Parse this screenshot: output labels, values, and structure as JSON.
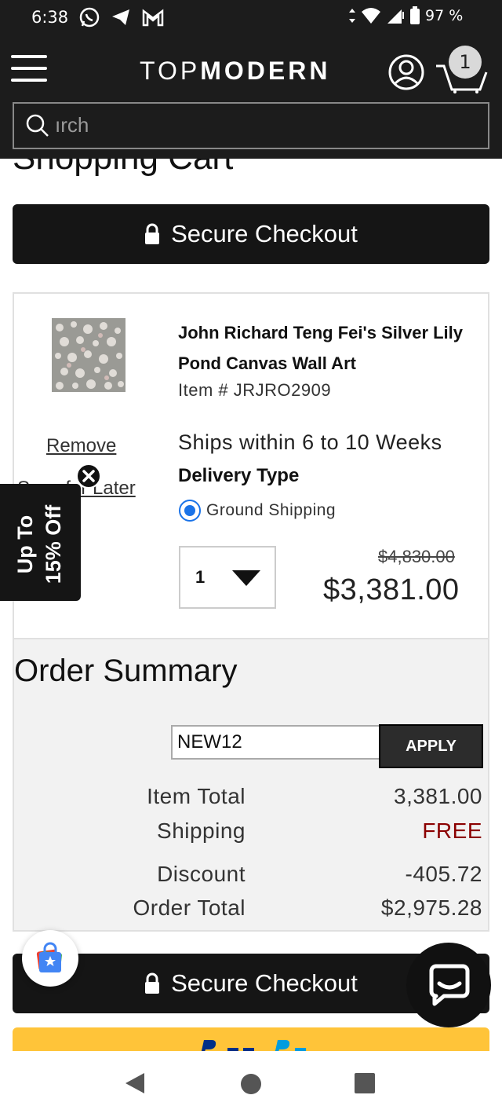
{
  "status_bar": {
    "time": "6:38",
    "battery": "97 %"
  },
  "header": {
    "logo_light": "TOP",
    "logo_bold": "MODERN",
    "cart_count": "1",
    "search_placeholder": "ırch"
  },
  "page": {
    "title": "Shopping Cart"
  },
  "checkout": {
    "label": "Secure Checkout"
  },
  "cart_item": {
    "name": "John Richard Teng Fei's Silver Lily Pond Canvas Wall Art",
    "item_number": "Item # JRJRO2909",
    "remove_label": "Remove",
    "save_later_label": "Save for Later",
    "ships_text": "Ships within 6 to 10 Weeks",
    "delivery_type_label": "Delivery Type",
    "shipping_option": "Ground Shipping",
    "quantity": "1",
    "original_price": "$4,830.00",
    "price": "$3,381.00"
  },
  "order_summary": {
    "title": "Order Summary",
    "promo_code": "NEW12",
    "apply_label": "APPLY",
    "item_total_label": "Item Total",
    "item_total_value": "3,381.00",
    "shipping_label": "Shipping",
    "shipping_value": "FREE",
    "discount_label": "Discount",
    "discount_value": "-405.72",
    "order_total_label": "Order Total",
    "order_total_value": "$2,975.28"
  },
  "promo_tab": {
    "line1": "Up To",
    "line2": "15% Off"
  },
  "colors": {
    "header_bg": "#1c1c1c",
    "shipping_free": "#8b0000",
    "radio_blue": "#1a73e8",
    "paypal_yellow": "#ffc439"
  }
}
